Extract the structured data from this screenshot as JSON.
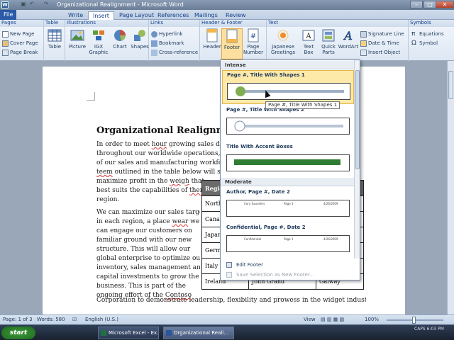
{
  "window": {
    "title": "Organizational Realignment - Microsoft Word",
    "controls": [
      "–",
      "□",
      "✕"
    ]
  },
  "tabs": {
    "file": "File",
    "items": [
      "Write",
      "Insert",
      "Page Layout",
      "References",
      "Mailings",
      "Review"
    ],
    "active": "Insert"
  },
  "ribbon": {
    "groups": {
      "pages": "Pages",
      "table": "Table",
      "illustrations": "Illustrations",
      "links": "Links",
      "header_footer": "Header & Footer",
      "text": "Text",
      "symbols": "Symbols"
    },
    "pages": [
      "New Page",
      "Cover Page",
      "Page Break"
    ],
    "table": "Table",
    "illustrations": {
      "picture": "Picture",
      "igx": "IGX",
      "igx2": "Graphic",
      "chart": "Chart",
      "shapes": "Shapes"
    },
    "links": [
      "Hyperlink",
      "Bookmark",
      "Cross-reference"
    ],
    "header_footer": {
      "header": "Header",
      "footer": "Footer",
      "page_number": "Page",
      "page_number2": "Number"
    },
    "text": {
      "japanese": "Japanese",
      "japanese2": "Greetings",
      "textbox": "Text",
      "textbox2": "Box",
      "quickparts": "Quick",
      "quickparts2": "Parts",
      "wordart": "WordArt",
      "small": [
        "Signature Line",
        "Date & Time",
        "Insert Object"
      ]
    },
    "symbols": [
      "Equations",
      "Symbol"
    ]
  },
  "document": {
    "title": "Organizational Realignme",
    "para1": [
      [
        "In order to meet ",
        "hour",
        " growing sales deman"
      ],
      [
        "throughout our worldwide operations, ",
        "Cont",
        ""
      ],
      [
        "of our sales and manufacturing workforce w",
        "",
        ""
      ],
      [
        "",
        "teem",
        " outlined in the table below will stream"
      ],
      [
        "maximize profit in the ",
        "weigh",
        " that"
      ],
      [
        "best suits the capabilities of ",
        "there",
        ""
      ],
      [
        "region.",
        "",
        ""
      ]
    ],
    "para2": [
      [
        "We can maximize our sales targets",
        "",
        ""
      ],
      [
        "in each region, a place ",
        "wear",
        " we"
      ],
      [
        "can engage our customers on",
        "",
        ""
      ],
      [
        "familiar ground with our new",
        "",
        ""
      ],
      [
        "structure. This will allow our",
        "",
        ""
      ],
      [
        "global enterprise to optimize our",
        "",
        ""
      ],
      [
        "inventory, sales management and",
        "",
        ""
      ],
      [
        "capital investments to grow the",
        "",
        ""
      ],
      [
        "business. This is part of the",
        "",
        ""
      ],
      [
        "ongoing effort of the ",
        "Contoso",
        ""
      ]
    ],
    "last_line": "Corporation to demonstrate leadership, flexibility and prowess in the widget industry.",
    "table": {
      "header": [
        "Regio",
        "",
        ""
      ],
      "rows": [
        [
          "North",
          "",
          ""
        ],
        [
          "Canad",
          "",
          ""
        ],
        [
          "Japan",
          "",
          ""
        ],
        [
          "Germa",
          "",
          ""
        ],
        [
          "Italy",
          "",
          ""
        ],
        [
          "Ireland",
          "John Grand",
          "Galway"
        ]
      ]
    }
  },
  "footer_gallery": {
    "sections": [
      "Intense",
      "Moderate"
    ],
    "items": [
      "Page #, Title With Shapes 1",
      "Page #, Title With Shapes 2",
      "Title With Accent Boxes",
      "Author, Page #, Date 2",
      "Confidential, Page #, Date 2"
    ],
    "preview_text": {
      "author": [
        "Cory Saunders",
        "Page 1",
        "4/26/2009"
      ],
      "confidential": [
        "Confidential",
        "Page 1",
        "4/26/2009"
      ]
    },
    "menu": [
      "Edit Footer",
      "Save Selection as New Footer..."
    ],
    "tooltip": "Page #, Title With Shapes 1",
    "accent_green": "#2e7d32"
  },
  "status": {
    "page": "Page: 1 of 3",
    "words": "Words: 580",
    "language": "English (U.S.)",
    "view": "View",
    "zoom": "100%"
  },
  "taskbar": {
    "start": "start",
    "tasks": [
      "Microsoft Excel - Ex...",
      "Organizational Reali..."
    ],
    "clock": "CAPS 6:03 PM"
  }
}
